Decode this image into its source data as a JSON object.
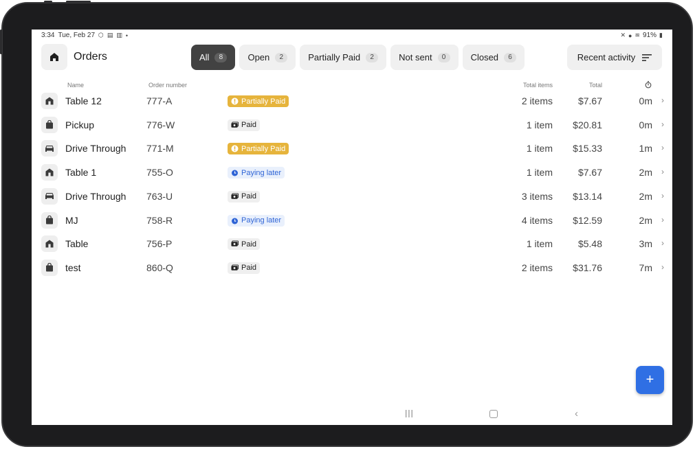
{
  "status_bar": {
    "time": "3:34",
    "date": "Tue, Feb 27",
    "battery": "91%"
  },
  "header": {
    "title": "Orders",
    "sort_label": "Recent activity"
  },
  "filters": [
    {
      "label": "All",
      "count": "8",
      "active": true
    },
    {
      "label": "Open",
      "count": "2",
      "active": false
    },
    {
      "label": "Partially Paid",
      "count": "2",
      "active": false
    },
    {
      "label": "Not sent",
      "count": "0",
      "active": false
    },
    {
      "label": "Closed",
      "count": "6",
      "active": false
    }
  ],
  "columns": {
    "name": "Name",
    "order_number": "Order number",
    "total_items": "Total items",
    "total": "Total"
  },
  "orders": [
    {
      "icon": "table-icon",
      "name": "Table 12",
      "order": "777-A",
      "status": "Partially Paid",
      "status_type": "partial",
      "items": "2 items",
      "total": "$7.67",
      "time": "0m"
    },
    {
      "icon": "bag-icon",
      "name": "Pickup",
      "order": "776-W",
      "status": "Paid",
      "status_type": "paid",
      "items": "1 item",
      "total": "$20.81",
      "time": "0m"
    },
    {
      "icon": "car-icon",
      "name": "Drive Through",
      "order": "771-M",
      "status": "Partially Paid",
      "status_type": "partial",
      "items": "1 item",
      "total": "$15.33",
      "time": "1m"
    },
    {
      "icon": "table-icon",
      "name": "Table 1",
      "order": "755-O",
      "status": "Paying later",
      "status_type": "later",
      "items": "1 item",
      "total": "$7.67",
      "time": "2m"
    },
    {
      "icon": "car-icon",
      "name": "Drive Through",
      "order": "763-U",
      "status": "Paid",
      "status_type": "paid",
      "items": "3 items",
      "total": "$13.14",
      "time": "2m"
    },
    {
      "icon": "bag-icon",
      "name": "MJ",
      "order": "758-R",
      "status": "Paying later",
      "status_type": "later",
      "items": "4 items",
      "total": "$12.59",
      "time": "2m"
    },
    {
      "icon": "table-icon",
      "name": "Table",
      "order": "756-P",
      "status": "Paid",
      "status_type": "paid",
      "items": "1 item",
      "total": "$5.48",
      "time": "3m"
    },
    {
      "icon": "bag-icon",
      "name": "test",
      "order": "860-Q",
      "status": "Paid",
      "status_type": "paid",
      "items": "2 items",
      "total": "$31.76",
      "time": "7m"
    }
  ],
  "fab": {
    "label": "+"
  },
  "colors": {
    "accent": "#2f6fe4",
    "partial": "#e6b43c",
    "later_text": "#2f64d6",
    "active_chip": "#424242"
  }
}
